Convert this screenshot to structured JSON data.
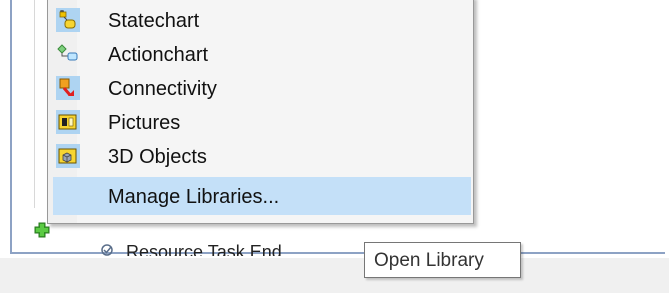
{
  "menu": {
    "items": [
      {
        "label": "Statechart",
        "icon": "statechart-icon"
      },
      {
        "label": "Actionchart",
        "icon": "actionchart-icon"
      },
      {
        "label": "Connectivity",
        "icon": "connectivity-icon"
      },
      {
        "label": "Pictures",
        "icon": "pictures-icon"
      },
      {
        "label": "3D Objects",
        "icon": "3d-objects-icon"
      }
    ],
    "manage_label": "Manage Libraries..."
  },
  "background": {
    "partial_item_label": "Resource Task End",
    "add_icon": "plus-icon"
  },
  "tooltip": {
    "text": "Open Library"
  },
  "colors": {
    "menu_background": "#f5f5f5",
    "highlight": "#c4e0f8",
    "selected_icon_bg": "#aed4f2",
    "frame_border": "#8da2c4"
  }
}
